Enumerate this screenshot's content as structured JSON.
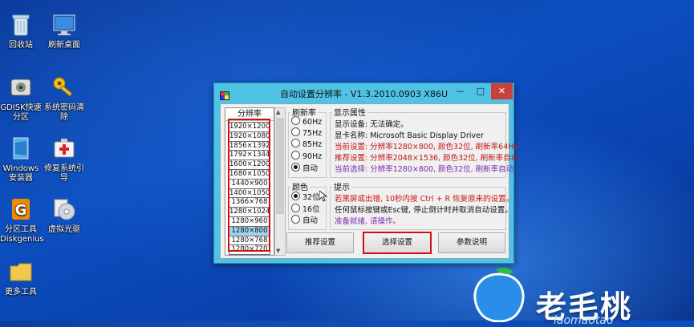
{
  "desktop": {
    "icons": [
      {
        "label": "回收站",
        "icon": "recycle-bin-icon"
      },
      {
        "label": "刷新桌面",
        "icon": "monitor-icon"
      },
      {
        "label": "GDISK快速分区",
        "icon": "disk-tool-icon"
      },
      {
        "label": "系统密码清除",
        "icon": "key-icon"
      },
      {
        "label": "Windows安装器",
        "icon": "windows-installer-icon"
      },
      {
        "label": "修复系统引导",
        "icon": "first-aid-icon"
      },
      {
        "label": "分区工具Diskgenius",
        "icon": "diskgenius-icon"
      },
      {
        "label": "虚拟光驱",
        "icon": "cd-drive-icon"
      },
      {
        "label": "更多工具",
        "icon": "folder-icon"
      }
    ],
    "watermark": {
      "text": "老毛桃",
      "url": "laomaotao"
    }
  },
  "window": {
    "title": "自动设置分辨率 - V1.3.2010.0903 X86U",
    "controls": {
      "minimize": "—",
      "maximize": "□",
      "close": "✕"
    },
    "resolution_list": {
      "header": "分辨率",
      "items": [
        "1920×1200",
        "1920×1080",
        "1856×1392",
        "1792×1344",
        "1600×1200",
        "1680×1050",
        "1440×900",
        "1400×1050",
        "1366×768",
        "1280×1024",
        "1280×960",
        "1280×800",
        "1280×768",
        "1280×720"
      ],
      "selected": "1280×800"
    },
    "refresh": {
      "label": "刷新率",
      "options": [
        "60Hz",
        "75Hz",
        "85Hz",
        "90Hz",
        "自动"
      ],
      "selected": "自动"
    },
    "color": {
      "label": "颜色",
      "options": [
        "32位",
        "16位",
        "自动"
      ],
      "selected": "32位"
    },
    "display_props": {
      "label": "显示属性",
      "lines": [
        {
          "text": "显示设备: 无法确定。",
          "color": "#111111"
        },
        {
          "text": "显卡名称: Microsoft Basic Display Driver",
          "color": "#111111"
        },
        {
          "text": "当前设置: 分辨率1280×800, 颜色32位, 刷新率64Hz",
          "color": "#c81414"
        },
        {
          "text": "推荐设置: 分辨率2048×1536, 颜色32位, 刷新率自动",
          "color": "#c81414"
        },
        {
          "text": "当前选择: 分辨率1280×800, 颜色32位, 刷新率自动",
          "color": "#7a2ab0"
        }
      ]
    },
    "tips": {
      "label": "提示",
      "lines": [
        {
          "text": "若黑屏或出错, 10秒内按 Ctrl + R 恢复原来的设置。",
          "color": "#c81414"
        },
        {
          "text": "任何鼠标按键或Esc键, 停止倒计时并取消自动设置。",
          "color": "#111111"
        },
        {
          "text": "准备就绪, 请操作。",
          "color": "#7a2ab0"
        }
      ]
    },
    "buttons": {
      "recommend": "推荐设置",
      "select": "选择设置",
      "help": "参数说明"
    }
  }
}
